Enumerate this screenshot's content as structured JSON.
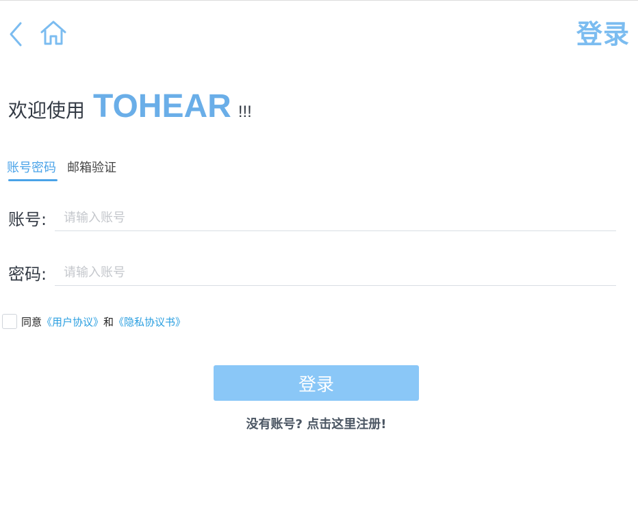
{
  "header": {
    "back_icon": "chevron-left-icon",
    "home_icon": "home-icon",
    "title": "登录",
    "accent_color": "#7bbcf0"
  },
  "welcome": {
    "prefix": "欢迎使用",
    "brand": "TOHEAR",
    "suffix": "!!!",
    "brand_color": "#6aaee8"
  },
  "tabs": [
    {
      "label": "账号密码",
      "active": true
    },
    {
      "label": "邮箱验证",
      "active": false
    }
  ],
  "form": {
    "account": {
      "label": "账号:",
      "value": "",
      "placeholder": "请输入账号"
    },
    "password": {
      "label": "密码:",
      "value": "",
      "placeholder": "请输入账号"
    }
  },
  "agreement": {
    "checked": false,
    "prefix": "同意",
    "user_agreement": "《用户协议》",
    "conjunction": "和",
    "privacy_policy": "《隐私协议书》",
    "link_color": "#2b9fe0"
  },
  "actions": {
    "login_label": "登录",
    "login_color": "#8ac7f7",
    "register_label": "没有账号? 点击这里注册!"
  }
}
